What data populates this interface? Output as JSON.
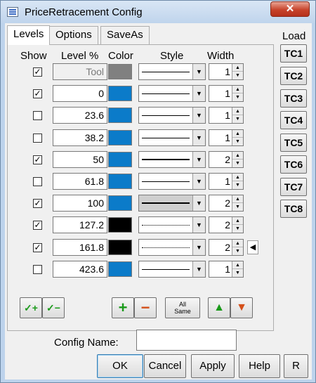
{
  "window": {
    "title": "PriceRetracement Config",
    "close_label": "✕"
  },
  "tabs": [
    {
      "label": "Levels",
      "active": true
    },
    {
      "label": "Options",
      "active": false
    },
    {
      "label": "SaveAs",
      "active": false
    }
  ],
  "headers": {
    "show": "Show",
    "level": "Level %",
    "color": "Color",
    "style": "Style",
    "width": "Width"
  },
  "load": {
    "label": "Load",
    "buttons": [
      "TC1",
      "TC2",
      "TC3",
      "TC4",
      "TC5",
      "TC6",
      "TC7",
      "TC8"
    ]
  },
  "rows": [
    {
      "checked": true,
      "check_glyph": "✓",
      "level": "Tool",
      "color": "#808080",
      "style": "solid",
      "width": "1"
    },
    {
      "checked": true,
      "check_glyph": "✓",
      "level": "0",
      "color": "#0b7bc9",
      "style": "solid",
      "width": "1"
    },
    {
      "checked": false,
      "check_glyph": "",
      "level": "23.6",
      "color": "#0b7bc9",
      "style": "solid",
      "width": "1"
    },
    {
      "checked": false,
      "check_glyph": "",
      "level": "38.2",
      "color": "#0b7bc9",
      "style": "solid",
      "width": "1"
    },
    {
      "checked": true,
      "check_glyph": "✓",
      "level": "50",
      "color": "#0b7bc9",
      "style": "thick",
      "width": "2"
    },
    {
      "checked": false,
      "check_glyph": "",
      "level": "61.8",
      "color": "#0b7bc9",
      "style": "solid",
      "width": "1"
    },
    {
      "checked": true,
      "check_glyph": "✓",
      "level": "100",
      "color": "#0b7bc9",
      "style": "thick-selected",
      "width": "2"
    },
    {
      "checked": true,
      "check_glyph": "✓",
      "level": "127.2",
      "color": "#000000",
      "style": "dotted",
      "width": "2"
    },
    {
      "checked": true,
      "check_glyph": "✓",
      "level": "161.8",
      "color": "#000000",
      "style": "dotted",
      "width": "2"
    },
    {
      "checked": false,
      "check_glyph": "",
      "level": "423.6",
      "color": "#0b7bc9",
      "style": "solid",
      "width": "1"
    }
  ],
  "row_marker": "◀",
  "icons": {
    "dropdown": "▼",
    "spin_up": "▲",
    "spin_down": "▼",
    "check_all": "✓+",
    "uncheck_all": "✓−",
    "add": "+",
    "remove": "−",
    "move_up": "▲",
    "move_down": "▼"
  },
  "tools": {
    "all_same_line1": "All",
    "all_same_line2": "Same"
  },
  "config": {
    "label": "Config Name:",
    "value": ""
  },
  "buttons": {
    "ok": "OK",
    "cancel": "Cancel",
    "apply": "Apply",
    "help": "Help",
    "reset": "R"
  }
}
